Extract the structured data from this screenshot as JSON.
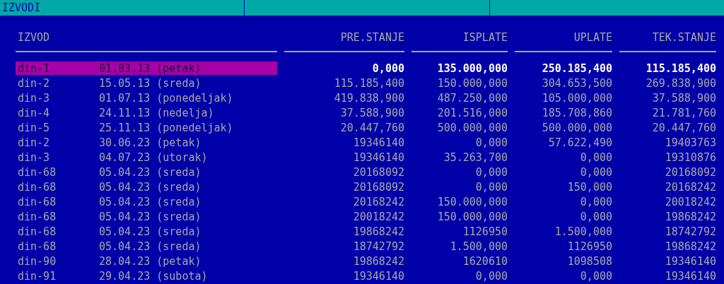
{
  "window": {
    "title": "IZVODI"
  },
  "table": {
    "columns": [
      "IZVOD",
      "PRE.STANJE",
      "ISPLATE",
      "UPLATE",
      "TEK.STANJE"
    ],
    "rows": [
      {
        "izvod": "din-1",
        "date": "01.03.13 (petak)",
        "pre": "0,000",
        "isplate": "135.000,000",
        "uplate": "250.185,400",
        "tek": "115.185,400",
        "selected": true
      },
      {
        "izvod": "din-2",
        "date": "15.05.13 (sreda)",
        "pre": "115.185,400",
        "isplate": "150.000,000",
        "uplate": "304.653,500",
        "tek": "269.838,900",
        "selected": false
      },
      {
        "izvod": "din-3",
        "date": "01.07.13 (ponedeljak)",
        "pre": "419.838,900",
        "isplate": "487.250,000",
        "uplate": "105.000,000",
        "tek": "37.588,900",
        "selected": false
      },
      {
        "izvod": "din-4",
        "date": "24.11.13 (nedelja)",
        "pre": "37.588,900",
        "isplate": "201.516,000",
        "uplate": "185.708,860",
        "tek": "21.781,760",
        "selected": false
      },
      {
        "izvod": "din-5",
        "date": "25.11.13 (ponedeljak)",
        "pre": "20.447,760",
        "isplate": "500.000,000",
        "uplate": "500.000,000",
        "tek": "20.447,760",
        "selected": false
      },
      {
        "izvod": "din-2",
        "date": "30.06.23 (petak)",
        "pre": "19346140",
        "isplate": "0,000",
        "uplate": "57.622,490",
        "tek": "19403763",
        "selected": false
      },
      {
        "izvod": "din-3",
        "date": "04.07.23 (utorak)",
        "pre": "19346140",
        "isplate": "35.263,700",
        "uplate": "0,000",
        "tek": "19310876",
        "selected": false
      },
      {
        "izvod": "din-68",
        "date": "05.04.23 (sreda)",
        "pre": "20168092",
        "isplate": "0,000",
        "uplate": "0,000",
        "tek": "20168092",
        "selected": false
      },
      {
        "izvod": "din-68",
        "date": "05.04.23 (sreda)",
        "pre": "20168092",
        "isplate": "0,000",
        "uplate": "150,000",
        "tek": "20168242",
        "selected": false
      },
      {
        "izvod": "din-68",
        "date": "05.04.23 (sreda)",
        "pre": "20168242",
        "isplate": "150.000,000",
        "uplate": "0,000",
        "tek": "20018242",
        "selected": false
      },
      {
        "izvod": "din-68",
        "date": "05.04.23 (sreda)",
        "pre": "20018242",
        "isplate": "150.000,000",
        "uplate": "0,000",
        "tek": "19868242",
        "selected": false
      },
      {
        "izvod": "din-68",
        "date": "05.04.23 (sreda)",
        "pre": "19868242",
        "isplate": "1126950",
        "uplate": "1.500,000",
        "tek": "18742792",
        "selected": false
      },
      {
        "izvod": "din-68",
        "date": "05.04.23 (sreda)",
        "pre": "18742792",
        "isplate": "1.500,000",
        "uplate": "1126950",
        "tek": "19868242",
        "selected": false
      },
      {
        "izvod": "din-90",
        "date": "28.04.23 (petak)",
        "pre": "19868242",
        "isplate": "1620610",
        "uplate": "1098508",
        "tek": "19346140",
        "selected": false
      },
      {
        "izvod": "din-91",
        "date": "29.04.23 (subota)",
        "pre": "19346140",
        "isplate": "0,000",
        "uplate": "0,000",
        "tek": "19346140",
        "selected": false
      }
    ]
  }
}
